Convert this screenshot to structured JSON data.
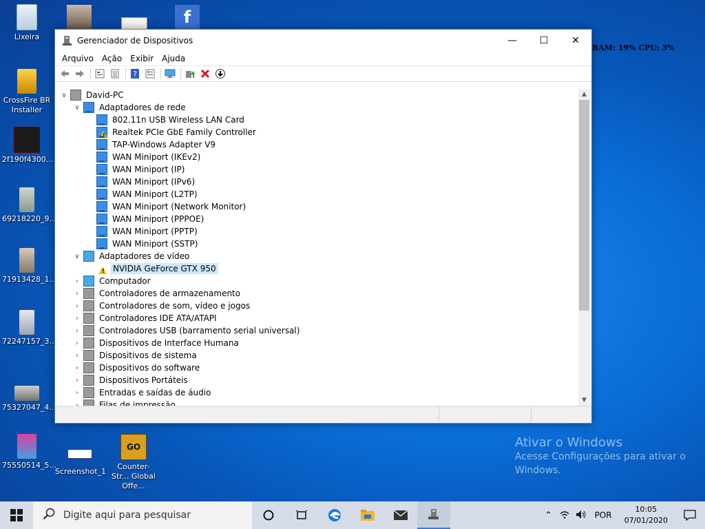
{
  "desktop": {
    "icons": [
      {
        "label": "Lixeira",
        "icon": "recycle-bin-icon"
      },
      {
        "label": "CrossFire BR Installer",
        "icon": "installer-icon"
      },
      {
        "label": "2f190f4300...",
        "icon": "image-file-icon"
      },
      {
        "label": "69218220_9...",
        "icon": "image-file-icon"
      },
      {
        "label": "71913428_1...",
        "icon": "image-file-icon"
      },
      {
        "label": "72247157_3...",
        "icon": "image-file-icon"
      },
      {
        "label": "75327047_4...",
        "icon": "image-file-icon"
      },
      {
        "label": "75550514_5...",
        "icon": "image-file-icon"
      },
      {
        "label": "Screenshot_1",
        "icon": "image-file-icon"
      },
      {
        "label": "Counter-Str... Global Offe...",
        "icon": "csgo-icon"
      }
    ],
    "overlay": "RAM: 19% CPU: 3%",
    "activation": {
      "title": "Ativar o Windows",
      "body": "Acesse Configurações para ativar o Windows."
    }
  },
  "window": {
    "title": "Gerenciador de Dispositivos",
    "controls": {
      "minimize": "—",
      "maximize": "☐",
      "close": "✕"
    },
    "menu": [
      "Arquivo",
      "Ação",
      "Exibir",
      "Ajuda"
    ],
    "tree": {
      "root": "David-PC",
      "network_category": "Adaptadores de rede",
      "network_items": [
        "802.11n USB Wireless LAN Card",
        "Realtek PCIe GbE Family Controller",
        "TAP-Windows Adapter V9",
        "WAN Miniport (IKEv2)",
        "WAN Miniport (IP)",
        "WAN Miniport (IPv6)",
        "WAN Miniport (L2TP)",
        "WAN Miniport (Network Monitor)",
        "WAN Miniport (PPPOE)",
        "WAN Miniport (PPTP)",
        "WAN Miniport (SSTP)"
      ],
      "video_category": "Adaptadores de vídeo",
      "video_items": [
        "NVIDIA GeForce GTX 950"
      ],
      "other_categories": [
        "Computador",
        "Controladores de armazenamento",
        "Controladores de som, vídeo e jogos",
        "Controladores IDE ATA/ATAPI",
        "Controladores USB (barramento serial universal)",
        "Dispositivos de Interface Humana",
        "Dispositivos de sistema",
        "Dispositivos do software",
        "Dispositivos Portáteis",
        "Entradas e saídas de áudio",
        "Filas de impressão"
      ]
    }
  },
  "taskbar": {
    "search_placeholder": "Digite aqui para pesquisar",
    "language": "POR",
    "time": "10:05",
    "date": "07/01/2020"
  }
}
